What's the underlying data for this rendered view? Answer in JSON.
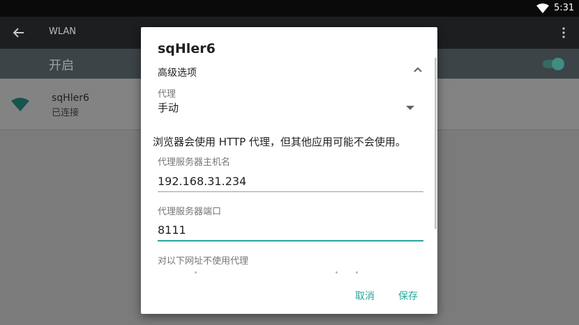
{
  "status_bar": {
    "time": "5:31",
    "wifi_icon": "wifi-signal-icon"
  },
  "app_bar": {
    "title": "WLAN",
    "back_icon": "arrow-back-icon",
    "more_icon": "more-vert-icon"
  },
  "switch_bar": {
    "label": "开启",
    "toggle_on": true,
    "accent": "#26a69a"
  },
  "network": {
    "name": "sqHler6",
    "status": "已连接",
    "icon": "wifi-full-icon"
  },
  "dialog": {
    "title": "sqHler6",
    "advanced_label": "高级选项",
    "advanced_icon": "chevron-up-icon",
    "proxy_label": "代理",
    "proxy_value": "手动",
    "proxy_dropdown_icon": "dropdown-arrow-icon",
    "warning": "浏览器会使用 HTTP 代理，但其他应用可能不会使用。",
    "host_label": "代理服务器主机名",
    "host_value": "192.168.31.234",
    "port_label": "代理服务器端口",
    "port_value": "8111",
    "bypass_label": "对以下网址不使用代理",
    "cancel_label": "取消",
    "save_label": "保存"
  },
  "colors": {
    "accent": "#26a69a",
    "status_bar": "#0a0a0a",
    "app_bar": "#1c1e20",
    "switch_bar": "#3c4447"
  }
}
